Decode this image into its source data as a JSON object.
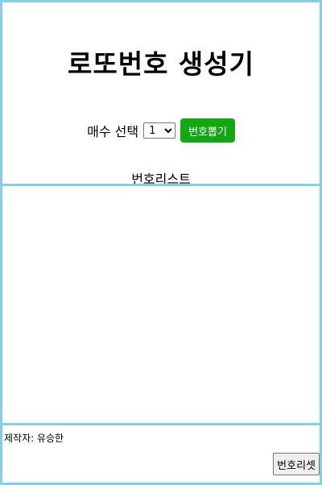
{
  "header": {
    "title": "로또번호 생성기",
    "count_label": "매수 선택",
    "count_select": {
      "selected": "1",
      "options": [
        "1"
      ]
    },
    "draw_button_label": "번호뽑기",
    "list_label": "번호리스트"
  },
  "list": {
    "items": []
  },
  "footer": {
    "author": "제작자: 유승한",
    "reset_button_label": "번호리셋"
  },
  "colors": {
    "border": "#87cde3",
    "draw_button": "#14a714"
  }
}
